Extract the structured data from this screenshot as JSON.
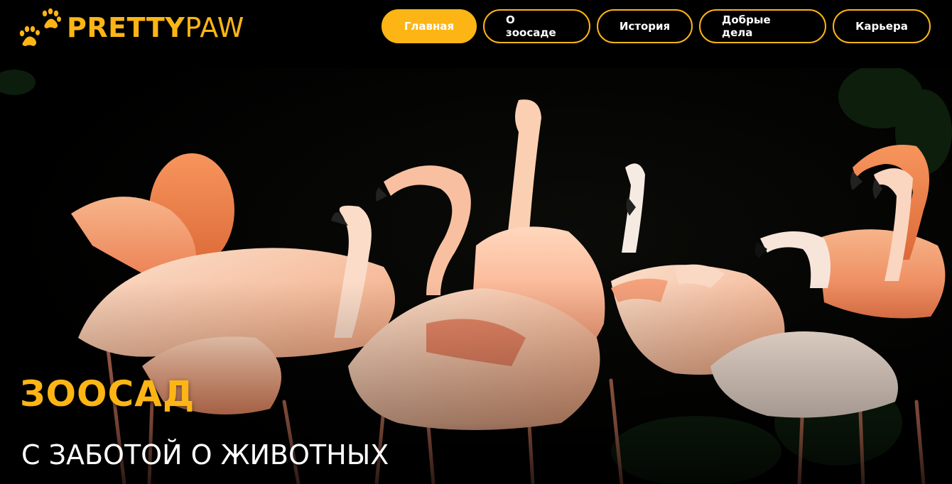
{
  "header": {
    "logo": {
      "text_bold": "PRETTY",
      "text_light": "PAW",
      "icon": "paw-prints-icon"
    },
    "nav": [
      {
        "label": "Главная",
        "active": true
      },
      {
        "label": "О зоосаде",
        "active": false
      },
      {
        "label": "История",
        "active": false
      },
      {
        "label": "Добрые дела",
        "active": false
      },
      {
        "label": "Карьера",
        "active": false
      }
    ]
  },
  "hero": {
    "title": "ЗООСАД",
    "subtitle": "С ЗАБОТОЙ О ЖИВОТНЫХ",
    "image": "flamingos-photo"
  },
  "colors": {
    "accent": "#fdb515",
    "background": "#000000",
    "text": "#ffffff"
  }
}
